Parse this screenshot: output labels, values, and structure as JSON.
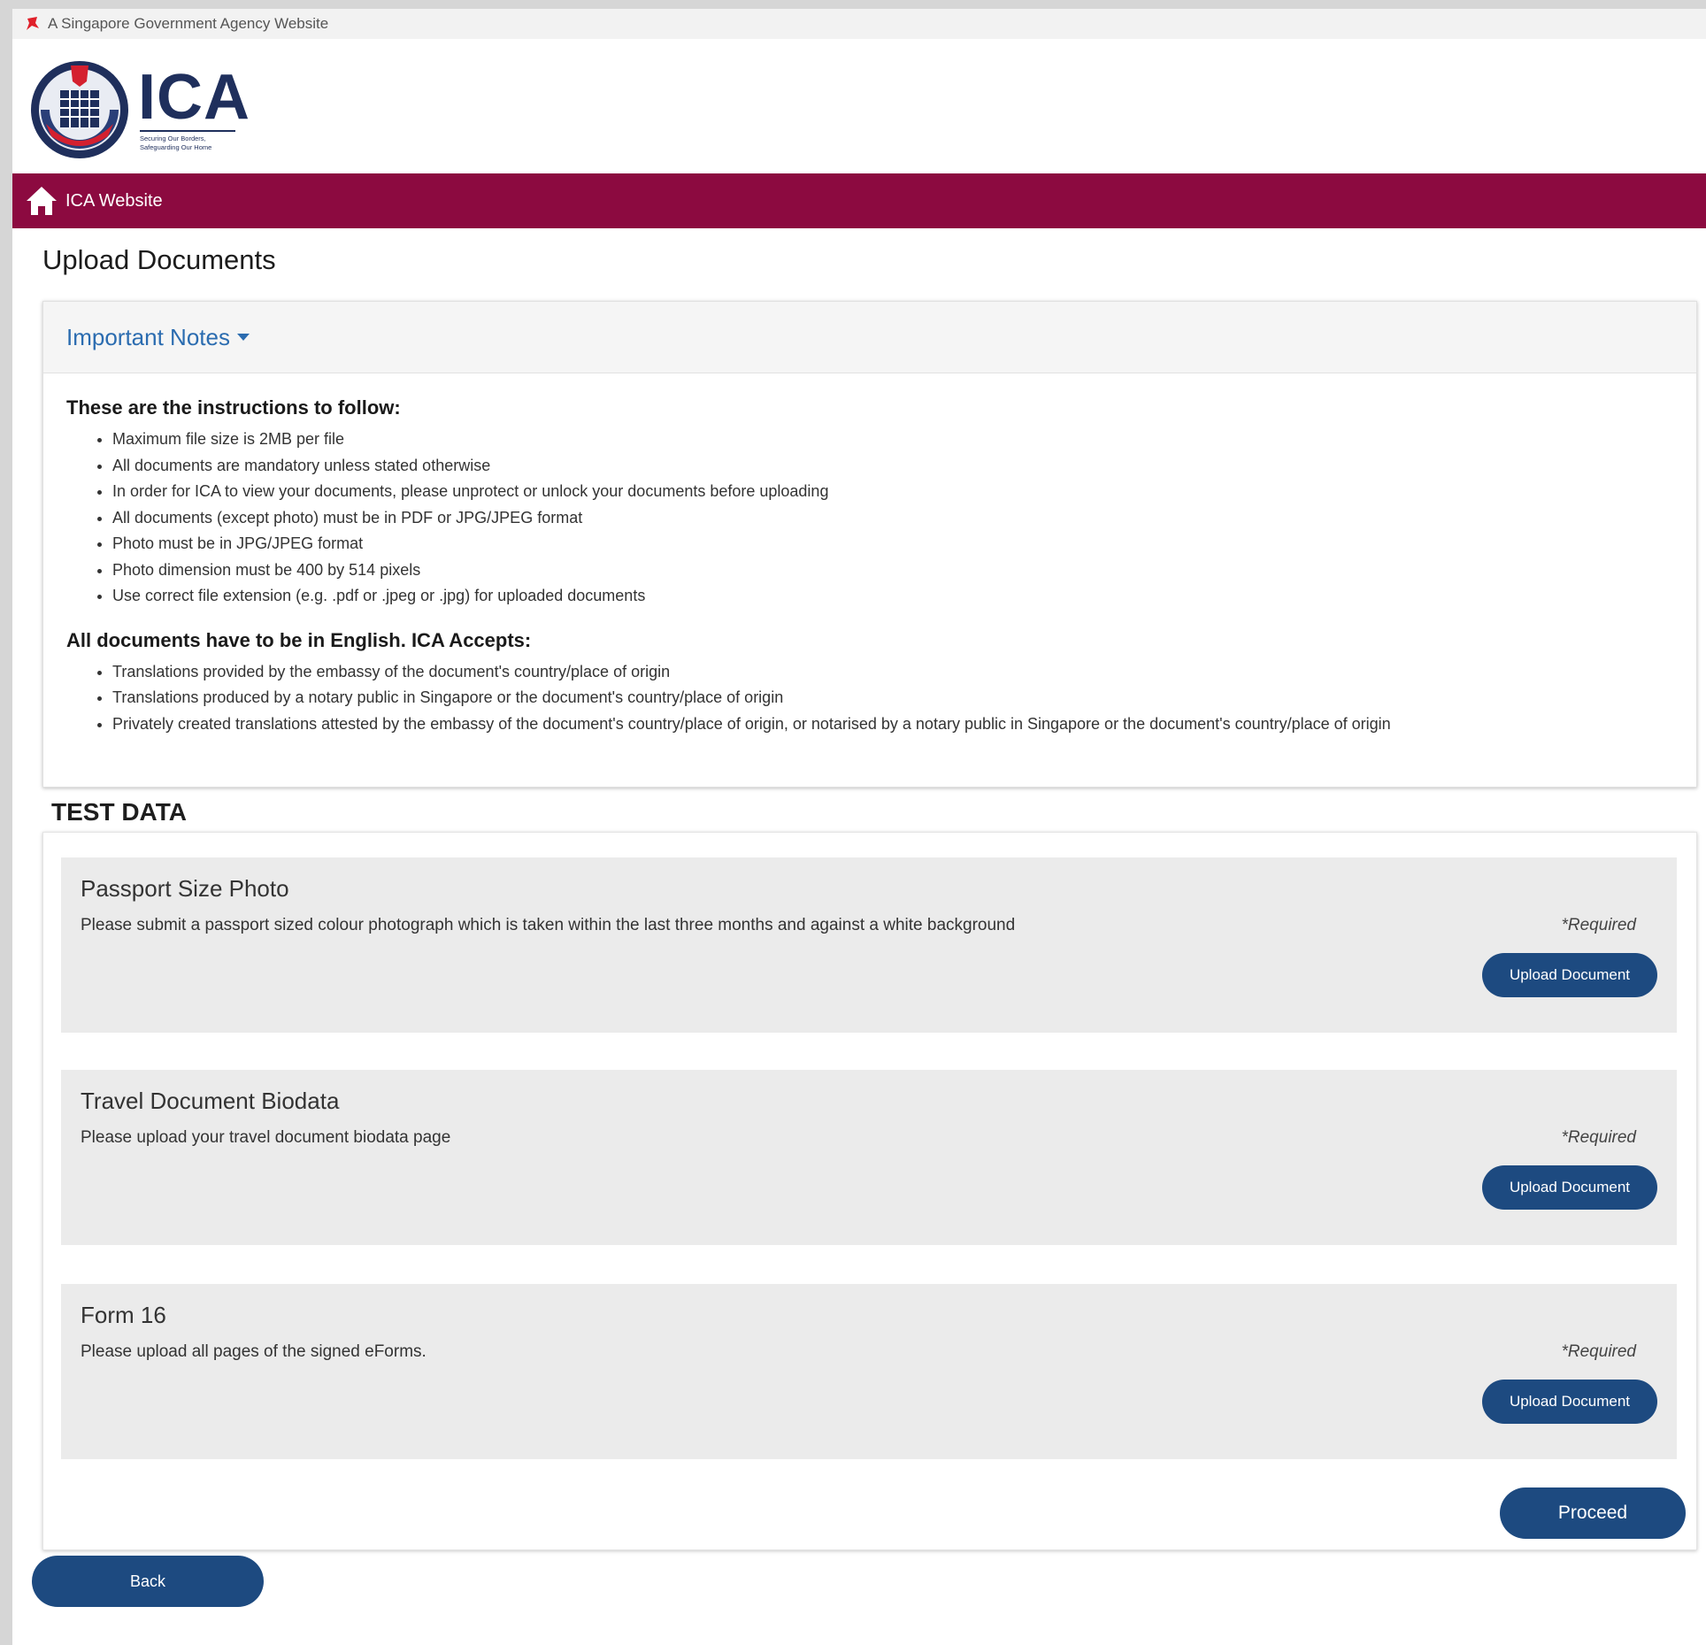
{
  "gov_banner": {
    "text": "A Singapore Government Agency Website"
  },
  "header": {
    "logo_text": "ICA",
    "logo_tagline_1": "Securing Our Borders,",
    "logo_tagline_2": "Safeguarding Our Home"
  },
  "nav": {
    "home_label": "ICA Website"
  },
  "page": {
    "title": "Upload Documents"
  },
  "notes": {
    "toggle_label": "Important Notes",
    "instructions_title": "These are the instructions to follow:",
    "instructions": [
      "Maximum file size is 2MB per file",
      "All documents are mandatory unless stated otherwise",
      "In order for ICA to view your documents, please unprotect or unlock your documents before uploading",
      "All documents (except photo) must be in PDF or JPG/JPEG format",
      "Photo must be in JPG/JPEG format",
      "Photo dimension must be 400 by 514 pixels",
      "Use correct file extension (e.g. .pdf or .jpeg or .jpg) for uploaded documents"
    ],
    "english_title": "All documents have to be in English. ICA Accepts:",
    "english_items": [
      "Translations provided by the embassy of the document's country/place of origin",
      "Translations produced by a notary public in Singapore or the document's country/place of origin",
      "Privately created translations attested by the embassy of the document's country/place of origin, or notarised by a notary public in Singapore or the document's country/place of origin"
    ]
  },
  "section": {
    "title": "TEST DATA"
  },
  "documents": [
    {
      "name": "Passport Size Photo",
      "description": "Please submit a passport sized colour photograph which is taken within the last three months and against a white background",
      "required": "*Required",
      "button": "Upload Document"
    },
    {
      "name": "Travel Document Biodata",
      "description": "Please upload your travel document biodata page",
      "required": "*Required",
      "button": "Upload Document"
    },
    {
      "name": "Form 16",
      "description": "Please upload all pages of the signed eForms.",
      "required": "*Required",
      "button": "Upload Document"
    }
  ],
  "actions": {
    "proceed": "Proceed",
    "back": "Back"
  },
  "colors": {
    "brand_maroon": "#8c0a40",
    "button_blue": "#1d4a80",
    "link_blue": "#2b6cb0"
  }
}
